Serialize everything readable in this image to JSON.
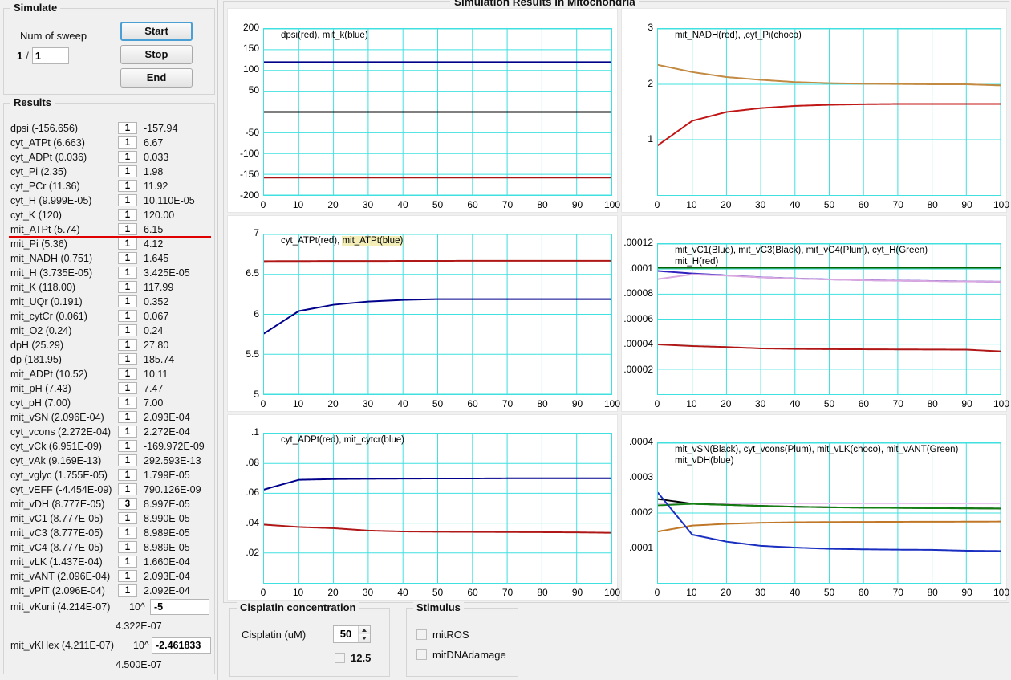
{
  "simulate": {
    "title": "Simulate",
    "sweep_label": "Num of sweep",
    "sweep_current": "1",
    "sweep_separator": "/",
    "sweep_total": "1",
    "start_label": "Start",
    "stop_label": "Stop",
    "end_label": "End"
  },
  "results": {
    "title": "Results",
    "rows": [
      {
        "name": "dpsi (-156.656)",
        "mult": "1",
        "value": "-157.94"
      },
      {
        "name": "cyt_ATPt (6.663)",
        "mult": "1",
        "value": "6.67"
      },
      {
        "name": "cyt_ADPt (0.036)",
        "mult": "1",
        "value": "0.033"
      },
      {
        "name": "cyt_Pi (2.35)",
        "mult": "1",
        "value": "1.98"
      },
      {
        "name": "cyt_PCr (11.36)",
        "mult": "1",
        "value": "11.92"
      },
      {
        "name": "cyt_H (9.999E-05)",
        "mult": "1",
        "value": "10.110E-05"
      },
      {
        "name": "cyt_K (120)",
        "mult": "1",
        "value": "120.00"
      },
      {
        "name": "mit_ATPt (5.74)",
        "mult": "1",
        "value": "6.15",
        "divider": true
      },
      {
        "name": "mit_Pi (5.36)",
        "mult": "1",
        "value": "4.12"
      },
      {
        "name": "mit_NADH (0.751)",
        "mult": "1",
        "value": "1.645"
      },
      {
        "name": "mit_H (3.735E-05)",
        "mult": "1",
        "value": "3.425E-05"
      },
      {
        "name": "mit_K (118.00)",
        "mult": "1",
        "value": "117.99"
      },
      {
        "name": "mit_UQr (0.191)",
        "mult": "1",
        "value": "0.352"
      },
      {
        "name": "mit_cytCr (0.061)",
        "mult": "1",
        "value": "0.067"
      },
      {
        "name": "mit_O2 (0.24)",
        "mult": "1",
        "value": "0.24"
      },
      {
        "name": "dpH (25.29)",
        "mult": "1",
        "value": "27.80"
      },
      {
        "name": "dp (181.95)",
        "mult": "1",
        "value": "185.74"
      },
      {
        "name": "mit_ADPt (10.52)",
        "mult": "1",
        "value": "10.11"
      },
      {
        "name": "mit_pH (7.43)",
        "mult": "1",
        "value": "7.47"
      },
      {
        "name": "cyt_pH (7.00)",
        "mult": "1",
        "value": "7.00"
      },
      {
        "name": "mit_vSN (2.096E-04)",
        "mult": "1",
        "value": "2.093E-04"
      },
      {
        "name": "cyt_vcons (2.272E-04)",
        "mult": "1",
        "value": "2.272E-04"
      },
      {
        "name": "cyt_vCk (6.951E-09)",
        "mult": "1",
        "value": "-169.972E-09"
      },
      {
        "name": "cyt_vAk (9.169E-13)",
        "mult": "1",
        "value": "292.593E-13"
      },
      {
        "name": "cyt_vglyc (1.755E-05)",
        "mult": "1",
        "value": "1.799E-05"
      },
      {
        "name": "cyt_vEFF (-4.454E-09)",
        "mult": "1",
        "value": "790.126E-09"
      },
      {
        "name": "mit_vDH (8.777E-05)",
        "mult": "3",
        "value": "8.997E-05"
      },
      {
        "name": "mit_vC1 (8.777E-05)",
        "mult": "1",
        "value": "8.990E-05"
      },
      {
        "name": "mit_vC3 (8.777E-05)",
        "mult": "1",
        "value": "8.989E-05"
      },
      {
        "name": "mit_vC4 (8.777E-05)",
        "mult": "1",
        "value": "8.989E-05"
      },
      {
        "name": "mit_vLK (1.437E-04)",
        "mult": "1",
        "value": "1.660E-04"
      },
      {
        "name": "mit_vANT (2.096E-04)",
        "mult": "1",
        "value": "2.093E-04"
      },
      {
        "name": "mit_vPiT (2.096E-04)",
        "mult": "1",
        "value": "2.092E-04"
      }
    ],
    "exponents": [
      {
        "name": "mit_vKuni (4.214E-07)",
        "pow_label": "10^",
        "input": "-5",
        "result": "4.322E-07"
      },
      {
        "name": "mit_vKHex (4.211E-07)",
        "pow_label": "10^",
        "input": "-2.461833",
        "result": "4.500E-07"
      }
    ]
  },
  "charts_panel": {
    "title": "Simulation Results in Mitochondria"
  },
  "cisplatin": {
    "title": "Cisplatin concentration",
    "field_label": "Cisplatin (uM)",
    "value": "50",
    "checkbox_label": "12.5",
    "checkbox_checked": false
  },
  "stimulus": {
    "title": "Stimulus",
    "items": [
      {
        "label": "mitROS",
        "checked": false
      },
      {
        "label": "mitDNAdamage",
        "checked": false
      }
    ]
  },
  "chart_data": [
    {
      "id": "chart-dpsi-mitk",
      "type": "line",
      "title": "dpsi(red), mit_k(blue)",
      "legend_parts": [
        {
          "text": "dpsi(red), mit_k(blue)",
          "highlight": false
        }
      ],
      "xlabel": "",
      "ylabel": "",
      "xlim": [
        0,
        100
      ],
      "ylim": [
        -200,
        200
      ],
      "xticks": [
        0,
        10,
        20,
        30,
        40,
        50,
        60,
        70,
        80,
        90,
        100
      ],
      "yticks": [
        200,
        150,
        100,
        50,
        -50,
        -100,
        -150,
        -200
      ],
      "grid": true,
      "series": [
        {
          "name": "mit_k",
          "color": "#00008b",
          "values": [
            120,
            120,
            120,
            120,
            120,
            120,
            120,
            120,
            120,
            120,
            120
          ]
        },
        {
          "name": "zero",
          "color": "#000000",
          "values": [
            0,
            0,
            0,
            0,
            0,
            0,
            0,
            0,
            0,
            0,
            0
          ]
        },
        {
          "name": "dpsi",
          "color": "#a81515",
          "values": [
            -157.94,
            -157.94,
            -157.94,
            -157.94,
            -157.94,
            -157.94,
            -157.94,
            -157.94,
            -157.94,
            -157.94,
            -157.94
          ]
        }
      ]
    },
    {
      "id": "chart-nadh-pi",
      "type": "line",
      "title": "mit_NADH(red), ,cyt_Pi(choco)",
      "legend_parts": [
        {
          "text": "mit_NADH(red), ,cyt_Pi(choco)",
          "highlight": false
        }
      ],
      "xlabel": "",
      "ylabel": "",
      "xlim": [
        0,
        100
      ],
      "ylim": [
        0,
        3
      ],
      "xticks": [
        0,
        10,
        20,
        30,
        40,
        50,
        60,
        70,
        80,
        90,
        100
      ],
      "yticks": [
        3,
        2,
        1
      ],
      "grid": true,
      "series": [
        {
          "name": "cyt_Pi",
          "color": "#c28a42",
          "values": [
            2.35,
            2.22,
            2.13,
            2.08,
            2.04,
            2.02,
            2.01,
            2.005,
            2.0,
            2.0,
            1.98
          ]
        },
        {
          "name": "mit_NADH",
          "color": "#c11616",
          "values": [
            0.9,
            1.34,
            1.5,
            1.57,
            1.61,
            1.63,
            1.64,
            1.645,
            1.645,
            1.645,
            1.645
          ]
        }
      ]
    },
    {
      "id": "chart-atp",
      "type": "line",
      "title": "cyt_ATPt(red), mit_ATPt(blue)",
      "legend_parts": [
        {
          "text": "cyt_ATPt(red), ",
          "highlight": false
        },
        {
          "text": "mit_ATPt(blue)",
          "highlight": true
        }
      ],
      "xlabel": "",
      "ylabel": "",
      "xlim": [
        0,
        100
      ],
      "ylim": [
        5,
        7
      ],
      "xticks": [
        0,
        10,
        20,
        30,
        40,
        50,
        60,
        70,
        80,
        90,
        100
      ],
      "yticks": [
        7,
        6.5,
        6,
        5.5,
        5
      ],
      "grid": true,
      "series": [
        {
          "name": "cyt_ATPt",
          "color": "#b01818",
          "values": [
            6.665,
            6.666,
            6.667,
            6.667,
            6.668,
            6.668,
            6.67,
            6.67,
            6.67,
            6.67,
            6.67
          ]
        },
        {
          "name": "mit_ATPt",
          "color": "#00008b",
          "values": [
            5.76,
            6.04,
            6.12,
            6.16,
            6.18,
            6.19,
            6.19,
            6.19,
            6.19,
            6.19,
            6.19
          ]
        }
      ]
    },
    {
      "id": "chart-vc",
      "type": "line",
      "title": "mit_vC1(Blue), mit_vC3(Black), mit_vC4(Plum), cyt_H(Green) mit_H(red)",
      "legend_parts": [
        {
          "text": "mit_vC1(Blue), mit_vC3(Black), mit_vC4(Plum),  cyt_H(Green)",
          "highlight": false
        },
        {
          "text": "mit_H(red)",
          "highlight": false
        }
      ],
      "xlabel": "",
      "ylabel": "",
      "xlim": [
        0,
        100
      ],
      "ylim": [
        0,
        0.00012
      ],
      "xticks": [
        0,
        10,
        20,
        30,
        40,
        50,
        60,
        70,
        80,
        90,
        100
      ],
      "yticks": [
        ".00012",
        ".0001",
        ".00008",
        ".00006",
        ".00004",
        ".00002"
      ],
      "grid": true,
      "series": [
        {
          "name": "cyt_H",
          "color": "#006400",
          "values": [
            0.0001011,
            0.0001011,
            0.0001011,
            0.0001011,
            0.0001011,
            0.0001011,
            0.0001011,
            0.0001011,
            0.0001011,
            0.0001011,
            0.0001011
          ]
        },
        {
          "name": "mit_vC1",
          "color": "#3020c0",
          "values": [
            9.85e-05,
            9.65e-05,
            9.5e-05,
            9.35e-05,
            9.25e-05,
            9.18e-05,
            9.12e-05,
            9.08e-05,
            9.05e-05,
            9.02e-05,
            8.99e-05
          ]
        },
        {
          "name": "mit_vC4",
          "color": "#d9a8e0",
          "values": [
            9.2e-05,
            9.58e-05,
            9.48e-05,
            9.34e-05,
            9.24e-05,
            9.17e-05,
            9.11e-05,
            9.07e-05,
            9.04e-05,
            9.01e-05,
            8.99e-05
          ]
        },
        {
          "name": "mit_H",
          "color": "#b01818",
          "values": [
            3.98e-05,
            3.85e-05,
            3.77e-05,
            3.66e-05,
            3.62e-05,
            3.6e-05,
            3.59e-05,
            3.58e-05,
            3.57e-05,
            3.56e-05,
            3.425e-05
          ]
        }
      ]
    },
    {
      "id": "chart-adp-cytcr",
      "type": "line",
      "title": "cyt_ADPt(red), mit_cytcr(blue)",
      "legend_parts": [
        {
          "text": "cyt_ADPt(red), mit_cytcr(blue)",
          "highlight": false
        }
      ],
      "xlabel": "",
      "ylabel": "",
      "xlim": [
        0,
        100
      ],
      "ylim": [
        0,
        0.1
      ],
      "xticks": [
        0,
        10,
        20,
        30,
        40,
        50,
        60,
        70,
        80,
        90,
        100
      ],
      "yticks": [
        ".1",
        ".08",
        ".06",
        ".04",
        ".02"
      ],
      "grid": true,
      "series": [
        {
          "name": "mit_cytcr",
          "color": "#00008b",
          "values": [
            0.0625,
            0.069,
            0.0695,
            0.0697,
            0.0698,
            0.0699,
            0.0699,
            0.07,
            0.07,
            0.07,
            0.07
          ]
        },
        {
          "name": "cyt_ADPt",
          "color": "#b01818",
          "values": [
            0.039,
            0.0374,
            0.0366,
            0.035,
            0.0344,
            0.0342,
            0.0341,
            0.034,
            0.0339,
            0.0338,
            0.0335
          ]
        }
      ]
    },
    {
      "id": "chart-vsn",
      "type": "line",
      "title": "mit_vSN(Black), cyt_vcons(Plum), mit_vLK(choco), mit_vANT(Green) mit_vDH(blue)",
      "legend_parts": [
        {
          "text": "mit_vSN(Black), cyt_vcons(Plum), mit_vLK(choco), mit_vANT(Green)",
          "highlight": false
        },
        {
          "text": "mit_vDH(blue)",
          "highlight": false
        }
      ],
      "xlabel": "",
      "ylabel": "",
      "xlim": [
        0,
        100
      ],
      "ylim": [
        0,
        0.0004
      ],
      "xticks": [
        0,
        10,
        20,
        30,
        40,
        50,
        60,
        70,
        80,
        90,
        100
      ],
      "yticks": [
        ".0004",
        ".0003",
        ".0002",
        ".0001"
      ],
      "grid": true,
      "series": [
        {
          "name": "cyt_vcons",
          "color": "#e8c8ec",
          "values": [
            0.0002272,
            0.0002272,
            0.0002272,
            0.0002272,
            0.0002272,
            0.0002272,
            0.0002272,
            0.0002272,
            0.0002272,
            0.0002272,
            0.0002272
          ]
        },
        {
          "name": "mit_vSN",
          "color": "#000000",
          "values": [
            0.00024,
            0.0002265,
            0.0002235,
            0.0002205,
            0.000218,
            0.0002165,
            0.0002155,
            0.0002148,
            0.000214,
            0.0002135,
            0.000213
          ]
        },
        {
          "name": "mit_vANT",
          "color": "#148014",
          "values": [
            0.000222,
            0.0002262,
            0.0002232,
            0.0002202,
            0.0002178,
            0.0002163,
            0.0002153,
            0.0002146,
            0.0002139,
            0.0002134,
            0.0002128
          ]
        },
        {
          "name": "mit_vLK",
          "color": "#c07828",
          "values": [
            0.000147,
            0.000164,
            0.000169,
            0.000172,
            0.0001735,
            0.0001742,
            0.0001745,
            0.0001748,
            0.000175,
            0.0001752,
            0.0001755
          ]
        },
        {
          "name": "mit_vDH",
          "color": "#1a2fc0",
          "values": [
            0.000258,
            0.000138,
            0.000118,
            0.000106,
            0.000101,
            9.75e-05,
            9.6e-05,
            9.5e-05,
            9.45e-05,
            9.2e-05,
            9.12e-05
          ]
        }
      ]
    }
  ]
}
